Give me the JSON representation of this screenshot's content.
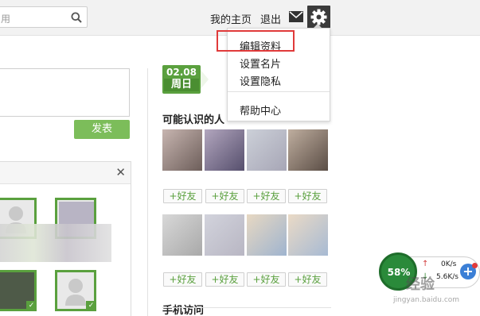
{
  "header": {
    "search_placeholder": "用",
    "nav_home": "我的主页",
    "nav_logout": "退出",
    "mail_icon": "envelope-icon",
    "settings_icon": "gear-icon"
  },
  "dropdown": {
    "items": [
      "编辑资料",
      "设置名片",
      "设置隐私",
      "帮助中心"
    ],
    "highlighted_index": 0,
    "highlight_color": "#e03a3a"
  },
  "composer": {
    "send_label": "发表"
  },
  "panel": {
    "close_label": "✕"
  },
  "calendar": {
    "date": "02.08",
    "weekday": "周日"
  },
  "friends": {
    "title": "可能认识的人",
    "add_label": "+好友",
    "mobile_title": "手机访问"
  },
  "speed_widget": {
    "percent": "58%",
    "upload": "0K/s",
    "download": "5.6K/s",
    "plus_label": "+"
  },
  "watermark": {
    "text": "经验",
    "url": "jingyan.baidu.com"
  },
  "colors": {
    "accent_green": "#5aa03e",
    "button_green": "#7cbd5a",
    "gear_bg": "#3b3b3b"
  }
}
